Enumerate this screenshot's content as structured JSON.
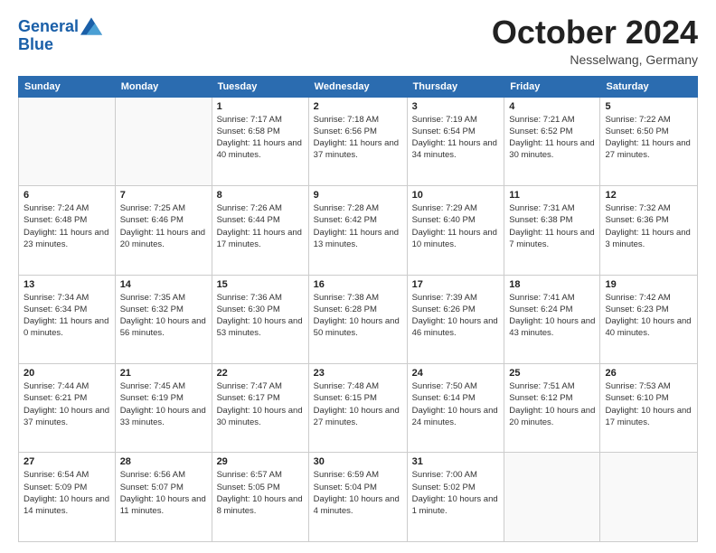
{
  "header": {
    "logo_line1": "General",
    "logo_line2": "Blue",
    "month": "October 2024",
    "location": "Nesselwang, Germany"
  },
  "weekdays": [
    "Sunday",
    "Monday",
    "Tuesday",
    "Wednesday",
    "Thursday",
    "Friday",
    "Saturday"
  ],
  "weeks": [
    [
      {
        "day": "",
        "info": ""
      },
      {
        "day": "",
        "info": ""
      },
      {
        "day": "1",
        "info": "Sunrise: 7:17 AM\nSunset: 6:58 PM\nDaylight: 11 hours and 40 minutes."
      },
      {
        "day": "2",
        "info": "Sunrise: 7:18 AM\nSunset: 6:56 PM\nDaylight: 11 hours and 37 minutes."
      },
      {
        "day": "3",
        "info": "Sunrise: 7:19 AM\nSunset: 6:54 PM\nDaylight: 11 hours and 34 minutes."
      },
      {
        "day": "4",
        "info": "Sunrise: 7:21 AM\nSunset: 6:52 PM\nDaylight: 11 hours and 30 minutes."
      },
      {
        "day": "5",
        "info": "Sunrise: 7:22 AM\nSunset: 6:50 PM\nDaylight: 11 hours and 27 minutes."
      }
    ],
    [
      {
        "day": "6",
        "info": "Sunrise: 7:24 AM\nSunset: 6:48 PM\nDaylight: 11 hours and 23 minutes."
      },
      {
        "day": "7",
        "info": "Sunrise: 7:25 AM\nSunset: 6:46 PM\nDaylight: 11 hours and 20 minutes."
      },
      {
        "day": "8",
        "info": "Sunrise: 7:26 AM\nSunset: 6:44 PM\nDaylight: 11 hours and 17 minutes."
      },
      {
        "day": "9",
        "info": "Sunrise: 7:28 AM\nSunset: 6:42 PM\nDaylight: 11 hours and 13 minutes."
      },
      {
        "day": "10",
        "info": "Sunrise: 7:29 AM\nSunset: 6:40 PM\nDaylight: 11 hours and 10 minutes."
      },
      {
        "day": "11",
        "info": "Sunrise: 7:31 AM\nSunset: 6:38 PM\nDaylight: 11 hours and 7 minutes."
      },
      {
        "day": "12",
        "info": "Sunrise: 7:32 AM\nSunset: 6:36 PM\nDaylight: 11 hours and 3 minutes."
      }
    ],
    [
      {
        "day": "13",
        "info": "Sunrise: 7:34 AM\nSunset: 6:34 PM\nDaylight: 11 hours and 0 minutes."
      },
      {
        "day": "14",
        "info": "Sunrise: 7:35 AM\nSunset: 6:32 PM\nDaylight: 10 hours and 56 minutes."
      },
      {
        "day": "15",
        "info": "Sunrise: 7:36 AM\nSunset: 6:30 PM\nDaylight: 10 hours and 53 minutes."
      },
      {
        "day": "16",
        "info": "Sunrise: 7:38 AM\nSunset: 6:28 PM\nDaylight: 10 hours and 50 minutes."
      },
      {
        "day": "17",
        "info": "Sunrise: 7:39 AM\nSunset: 6:26 PM\nDaylight: 10 hours and 46 minutes."
      },
      {
        "day": "18",
        "info": "Sunrise: 7:41 AM\nSunset: 6:24 PM\nDaylight: 10 hours and 43 minutes."
      },
      {
        "day": "19",
        "info": "Sunrise: 7:42 AM\nSunset: 6:23 PM\nDaylight: 10 hours and 40 minutes."
      }
    ],
    [
      {
        "day": "20",
        "info": "Sunrise: 7:44 AM\nSunset: 6:21 PM\nDaylight: 10 hours and 37 minutes."
      },
      {
        "day": "21",
        "info": "Sunrise: 7:45 AM\nSunset: 6:19 PM\nDaylight: 10 hours and 33 minutes."
      },
      {
        "day": "22",
        "info": "Sunrise: 7:47 AM\nSunset: 6:17 PM\nDaylight: 10 hours and 30 minutes."
      },
      {
        "day": "23",
        "info": "Sunrise: 7:48 AM\nSunset: 6:15 PM\nDaylight: 10 hours and 27 minutes."
      },
      {
        "day": "24",
        "info": "Sunrise: 7:50 AM\nSunset: 6:14 PM\nDaylight: 10 hours and 24 minutes."
      },
      {
        "day": "25",
        "info": "Sunrise: 7:51 AM\nSunset: 6:12 PM\nDaylight: 10 hours and 20 minutes."
      },
      {
        "day": "26",
        "info": "Sunrise: 7:53 AM\nSunset: 6:10 PM\nDaylight: 10 hours and 17 minutes."
      }
    ],
    [
      {
        "day": "27",
        "info": "Sunrise: 6:54 AM\nSunset: 5:09 PM\nDaylight: 10 hours and 14 minutes."
      },
      {
        "day": "28",
        "info": "Sunrise: 6:56 AM\nSunset: 5:07 PM\nDaylight: 10 hours and 11 minutes."
      },
      {
        "day": "29",
        "info": "Sunrise: 6:57 AM\nSunset: 5:05 PM\nDaylight: 10 hours and 8 minutes."
      },
      {
        "day": "30",
        "info": "Sunrise: 6:59 AM\nSunset: 5:04 PM\nDaylight: 10 hours and 4 minutes."
      },
      {
        "day": "31",
        "info": "Sunrise: 7:00 AM\nSunset: 5:02 PM\nDaylight: 10 hours and 1 minute."
      },
      {
        "day": "",
        "info": ""
      },
      {
        "day": "",
        "info": ""
      }
    ]
  ]
}
